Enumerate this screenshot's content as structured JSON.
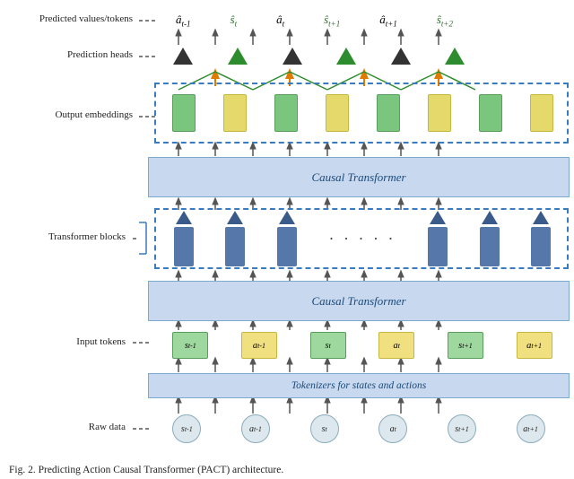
{
  "labels": {
    "predicted_values": "Predicted values/tokens",
    "prediction_heads": "Prediction heads",
    "output_embeddings": "Output embeddings",
    "transformer_blocks": "Transformer blocks",
    "input_tokens": "Input tokens",
    "raw_data": "Raw data",
    "causal_transformer": "Causal Transformer",
    "tokenizers": "Tokenizers for states and actions"
  },
  "math_symbols": {
    "a_tminus1_hat": "â",
    "a_tminus1_sub": "t-1",
    "s_t_hat": "ŝ",
    "s_t_sub": "t",
    "a_t_hat": "â",
    "a_t_sub": "t",
    "s_tplus1_hat": "ŝ",
    "s_tplus1_sub": "t+1",
    "a_tplus1_hat": "â",
    "a_tplus1_sub": "t+1",
    "s_tplus2_hat": "ŝ",
    "s_tplus2_sub": "t+2"
  },
  "input_tokens_labels": [
    {
      "text": "s",
      "sub": "t-1",
      "type": "green"
    },
    {
      "text": "a",
      "sub": "t-1",
      "type": "yellow"
    },
    {
      "text": "s",
      "sub": "t",
      "type": "green"
    },
    {
      "text": "a",
      "sub": "t",
      "type": "yellow"
    },
    {
      "text": "s",
      "sub": "t+1",
      "type": "green"
    },
    {
      "text": "a",
      "sub": "t+1",
      "type": "yellow"
    }
  ],
  "raw_data_labels": [
    {
      "text": "s",
      "sub": "t-1"
    },
    {
      "text": "a",
      "sub": "t-1"
    },
    {
      "text": "s",
      "sub": "t"
    },
    {
      "text": "a",
      "sub": "t"
    },
    {
      "text": "s",
      "sub": "t+1"
    },
    {
      "text": "a",
      "sub": "t+1"
    }
  ],
  "caption": "Fig. 2. Predicting Action Causal Transformer (PACT) architecture.",
  "colors": {
    "blue_accent": "#3a7abf",
    "causal_transformer_bg": "#c8d8ee",
    "green_embed": "#7bc67e",
    "yellow_embed": "#e6d96b",
    "block_blue": "#5577aa",
    "triangle_green": "#2d8c2d",
    "triangle_black": "#333333",
    "orange": "#e07b00"
  }
}
